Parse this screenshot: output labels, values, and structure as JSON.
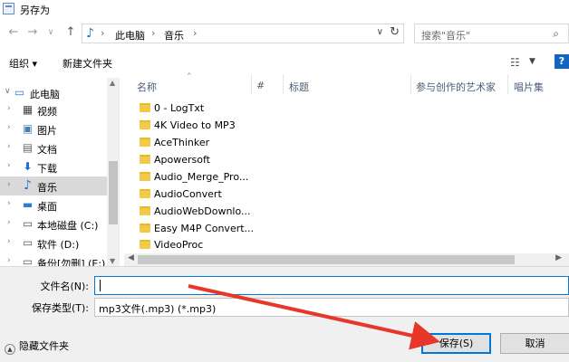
{
  "window": {
    "title": "另存为"
  },
  "nav": {
    "path": [
      "此电脑",
      "音乐"
    ],
    "search_placeholder": "搜索\"音乐\""
  },
  "toolbar": {
    "organize": "组织 ▾",
    "new_folder": "新建文件夹"
  },
  "sidebar": {
    "items": [
      {
        "label": "此电脑",
        "icon": "computer-icon",
        "expanded": true
      },
      {
        "label": "视频",
        "icon": "video-icon"
      },
      {
        "label": "图片",
        "icon": "picture-icon"
      },
      {
        "label": "文档",
        "icon": "document-icon"
      },
      {
        "label": "下载",
        "icon": "download-icon"
      },
      {
        "label": "音乐",
        "icon": "music-icon",
        "selected": true
      },
      {
        "label": "桌面",
        "icon": "desktop-icon"
      },
      {
        "label": "本地磁盘 (C:)",
        "icon": "disk-icon"
      },
      {
        "label": "软件 (D:)",
        "icon": "disk-icon"
      },
      {
        "label": "备份[勿删] (E:)",
        "icon": "disk-icon"
      }
    ]
  },
  "columns": {
    "name": "名称",
    "num": "#",
    "title": "标题",
    "artist": "参与创作的艺术家",
    "album": "唱片集"
  },
  "files": [
    "0 - LogTxt",
    "4K Video to MP3",
    "AceThinker",
    "Apowersoft",
    "Audio_Merge_Pro...",
    "AudioConvert",
    "AudioWebDownlo...",
    "Easy M4P Convert...",
    "VideoProc"
  ],
  "form": {
    "filename_label": "文件名(N):",
    "filename_value": "",
    "type_label": "保存类型(T):",
    "type_value": "mp3文件(.mp3) (*.mp3)"
  },
  "footer": {
    "hide_folders": "隐藏文件夹",
    "save": "保存(S)",
    "cancel": "取消"
  },
  "colors": {
    "accent": "#0078d7",
    "annotation_arrow": "#e8362a",
    "folder": "#f2c94c"
  }
}
